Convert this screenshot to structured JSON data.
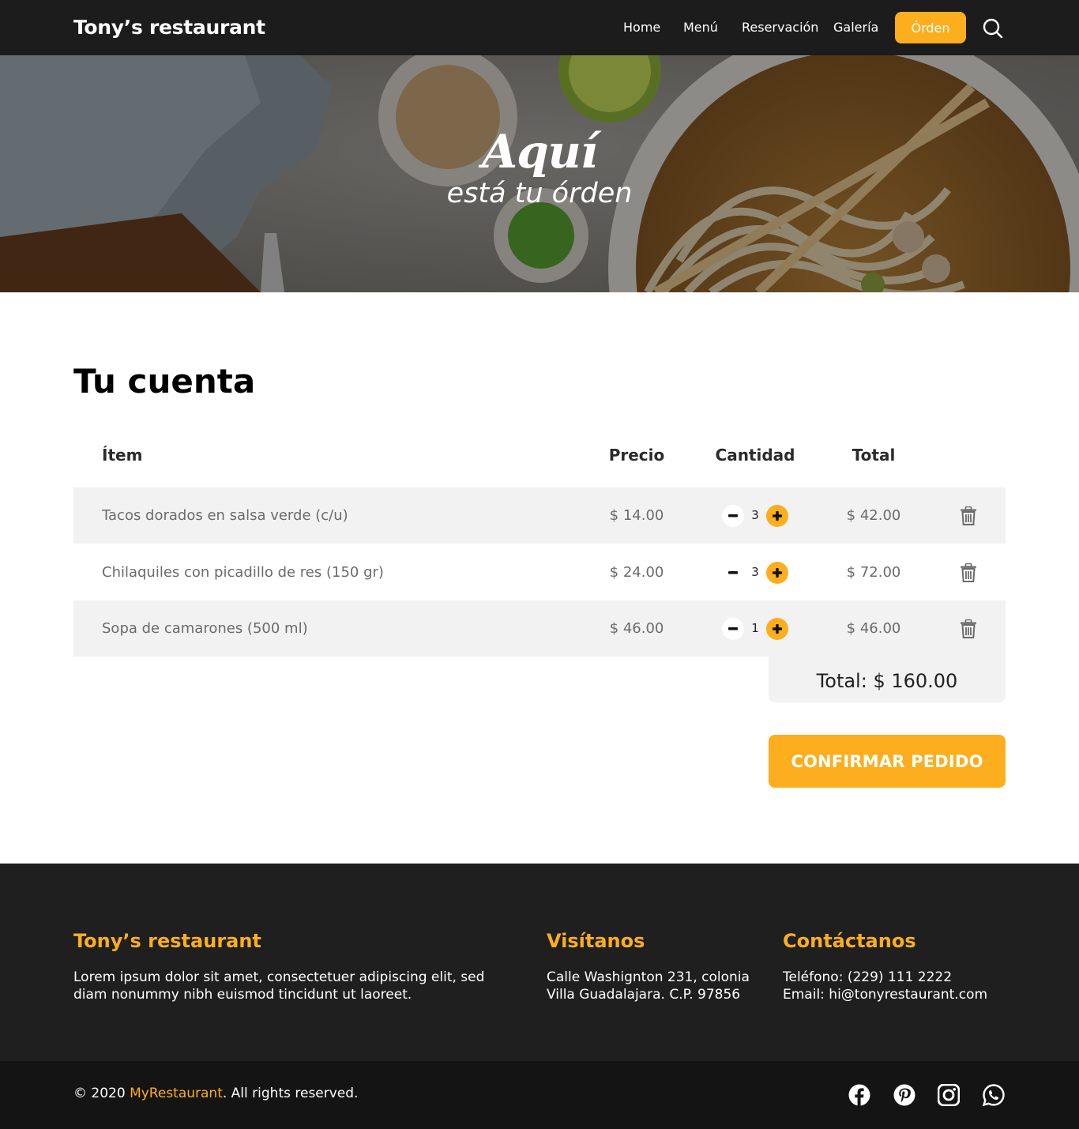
{
  "nav": {
    "brand": "Tony’s restaurant",
    "links": [
      "Home",
      "Menú",
      "Reservación",
      "Galería"
    ],
    "order_label": "Órden",
    "search_icon": "search-icon"
  },
  "hero": {
    "title": "Aquí",
    "subtitle": "está tu órden"
  },
  "main": {
    "title": "Tu cuenta",
    "columns": [
      "Ítem",
      "Precio",
      "Cantidad",
      "Total"
    ],
    "rows": [
      {
        "item": "Tacos dorados en salsa verde (c/u)",
        "price": "$ 14.00",
        "quantity": "3",
        "total": "$ 42.00"
      },
      {
        "item": "Chilaquiles con picadillo de res (150 gr)",
        "price": "$ 24.00",
        "quantity": "3",
        "total": "$ 72.00"
      },
      {
        "item": "Sopa de camarones (500 ml)",
        "price": "$ 46.00",
        "quantity": "1",
        "total": "$ 46.00"
      }
    ],
    "grand_total": "Total: $ 160.00",
    "confirm_label": "CONFIRMAR PEDIDO"
  },
  "footer": {
    "about_title": "Tony’s restaurant",
    "about_text": "Lorem ipsum dolor sit amet, consectetuer adipiscing elit, sed diam nonummy nibh euismod tincidunt ut laoreet.",
    "visit_title": "Visítanos",
    "visit_line1": "Calle Washignton 231, colonia",
    "visit_line2": "Villa Guadalajara. C.P. 97856",
    "contact_title": "Contáctanos",
    "contact_phone": "Teléfono: (229) 111 2222",
    "contact_email": "Email: hi@tonyrestaurant.com",
    "copyright_prefix": "© 2020 ",
    "copyright_brand": "MyRestaurant",
    "copyright_suffix": ". All rights reserved.",
    "social_icons": [
      "facebook-icon",
      "pinterest-icon",
      "instagram-icon",
      "whatsapp-icon"
    ]
  },
  "colors": {
    "accent": "#fcae1e",
    "nav_bg": "#1c1c1c",
    "footer_bg": "#1f1f1f",
    "bottom_bg": "#141414",
    "row_shade": "#f2f2f2"
  }
}
